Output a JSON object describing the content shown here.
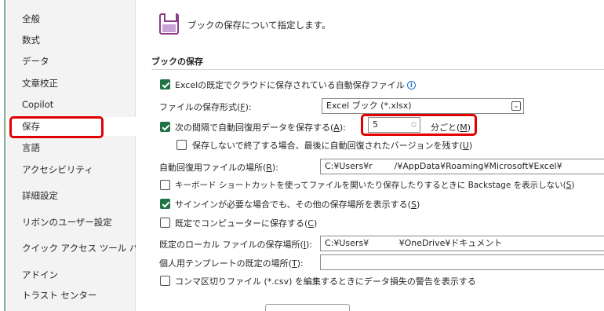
{
  "sidebar": {
    "items": [
      {
        "label": "全般"
      },
      {
        "label": "数式"
      },
      {
        "label": "データ"
      },
      {
        "label": "文章校正"
      },
      {
        "label": "Copilot"
      },
      {
        "label": "保存",
        "selected": true
      },
      {
        "label": "言語"
      },
      {
        "label": "アクセシビリティ"
      },
      {
        "label": "詳細設定"
      },
      {
        "label": "リボンのユーザー設定"
      },
      {
        "label": "クイック アクセス ツール バー"
      },
      {
        "label": "アドイン"
      },
      {
        "label": "トラスト センター"
      }
    ]
  },
  "header": {
    "icon": "save-icon",
    "text": "ブックの保存について指定します。"
  },
  "section": {
    "title": "ブックの保存"
  },
  "options": {
    "autosave_cloud": {
      "checked": true,
      "label": "Excelの既定でクラウドに保存されている自動保存ファイル",
      "icon": "info-icon"
    },
    "file_format": {
      "label": "ファイルの保存形式(",
      "key": "F",
      "label_end": "):",
      "value": "Excel ブック (*.xlsx)"
    },
    "autorecover": {
      "checked": true,
      "label": "次の間隔で自動回復用データを保存する(",
      "key": "A",
      "label_end": "):",
      "minutes": "5",
      "unit_label": "分ごと(",
      "unit_key": "M",
      "unit_end": ")"
    },
    "keep_last": {
      "checked": false,
      "label": "保存しないで終了する場合、最後に自動回復されたバージョンを残す(",
      "key": "U",
      "label_end": ")"
    },
    "autorecover_location": {
      "label": "自動回復用ファイルの場所(",
      "key": "R",
      "label_end": "):",
      "value": "C:¥Users¥r        /¥AppData¥Roaming¥Microsoft¥Excel¥"
    },
    "no_backstage": {
      "checked": false,
      "label": "キーボード ショートカットを使ってファイルを開いたり保存したりするときに Backstage を表示しない(",
      "key": "S",
      "label_end": ")"
    },
    "show_more_locations": {
      "checked": true,
      "label": "サインインが必要な場合でも、その他の保存場所を表示する(",
      "key": "S",
      "label_end": ")"
    },
    "save_to_computer": {
      "checked": false,
      "label": "既定でコンピューターに保存する(",
      "key": "C",
      "label_end": ")"
    },
    "local_location": {
      "label": "既定のローカル ファイルの保存場所(",
      "key": "I",
      "label_end": "):",
      "value": "C:¥Users¥           ¥OneDrive¥ドキュメント"
    },
    "template_location": {
      "label": "個人用テンプレートの既定の場所(",
      "key": "T",
      "label_end": "):",
      "value": ""
    },
    "csv_warning": {
      "checked": false,
      "label": "コンマ区切りファイル (*.csv) を編集するときにデータ損失の警告を表示する"
    }
  },
  "colors": {
    "highlight": "#e00000",
    "check": "#217346"
  }
}
